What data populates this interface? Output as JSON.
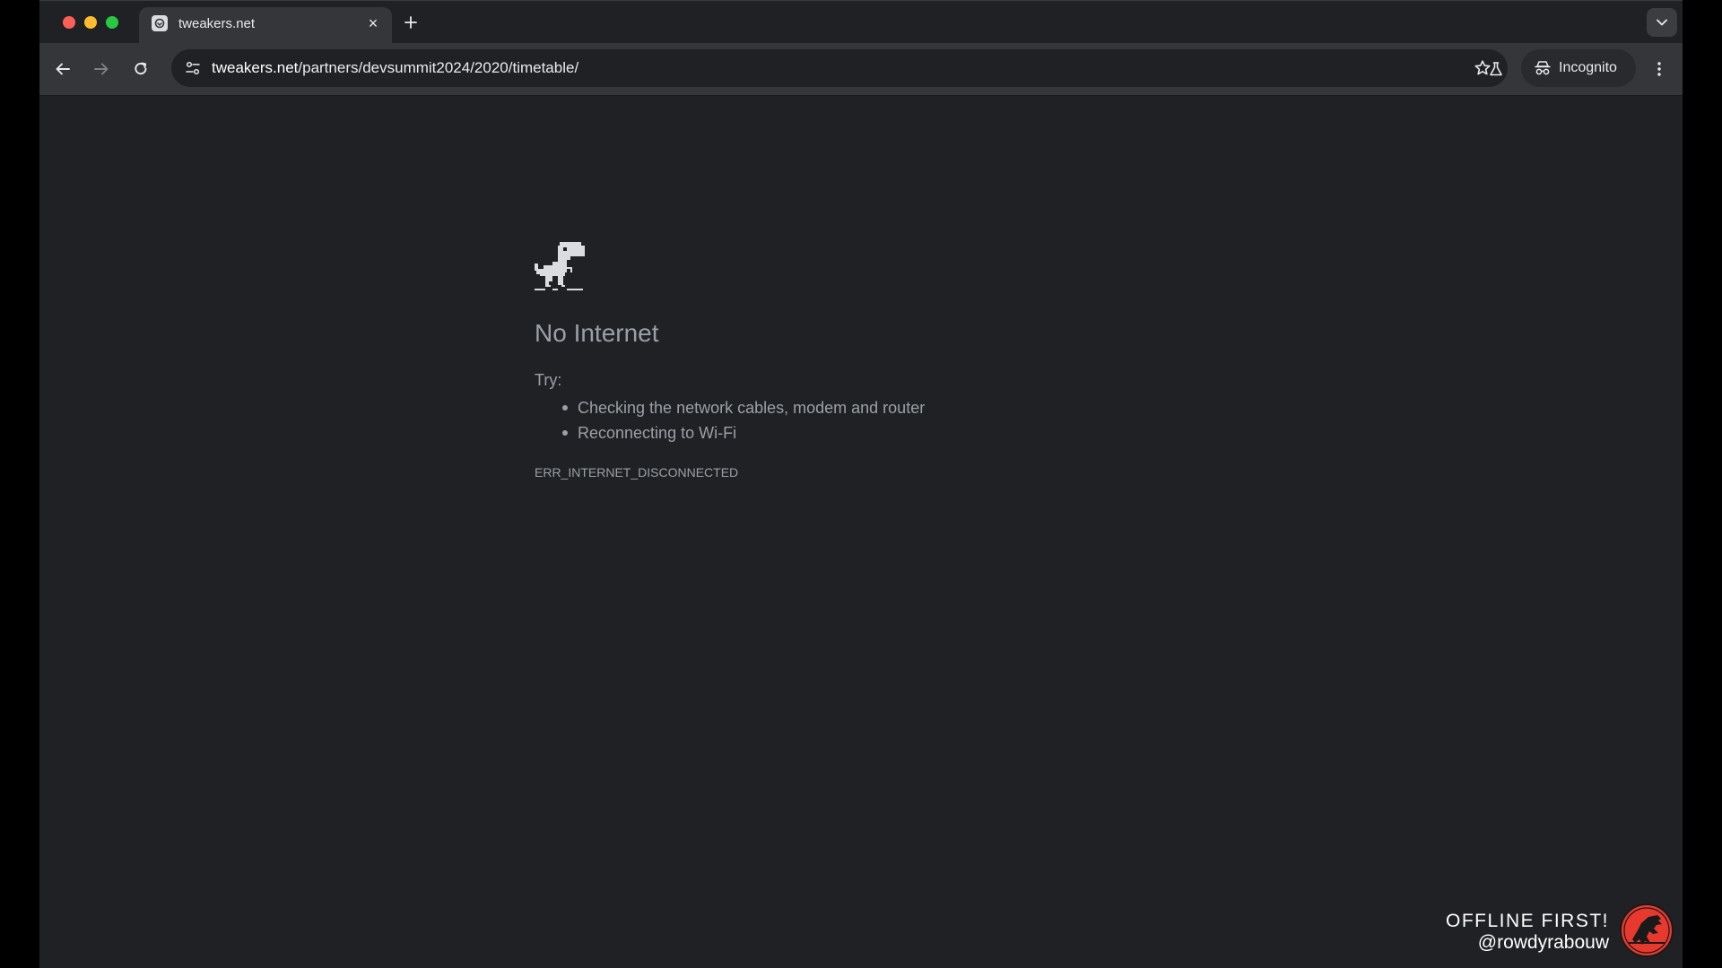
{
  "browser": {
    "tab": {
      "title": "tweakers.net",
      "close_glyph": "×",
      "favicon": "tweakers-favicon-icon"
    },
    "traffic_lights": {
      "close_color": "#ff5f57",
      "minimize_color": "#febc2e",
      "maximize_color": "#28c840"
    },
    "omnibox": {
      "host": "tweakers.net",
      "path": "/partners/devsummit2024/2020/timetable/"
    },
    "incognito_label": "Incognito"
  },
  "error_page": {
    "heading": "No Internet",
    "try_label": "Try:",
    "suggestions": [
      "Checking the network cables, modem and router",
      "Reconnecting to Wi-Fi"
    ],
    "error_code": "ERR_INTERNET_DISCONNECTED",
    "icon": "offline-dino-icon"
  },
  "watermark": {
    "line1": "OFFLINE FIRST!",
    "line2": "@rowdyrabouw",
    "logo": "jurassic-dino-logo",
    "logo_color": "#e8392e"
  },
  "colors": {
    "window_bg": "#202124",
    "toolbar_bg": "#35363a",
    "text_muted": "#9aa0a6",
    "text_primary": "#e8eaed"
  }
}
